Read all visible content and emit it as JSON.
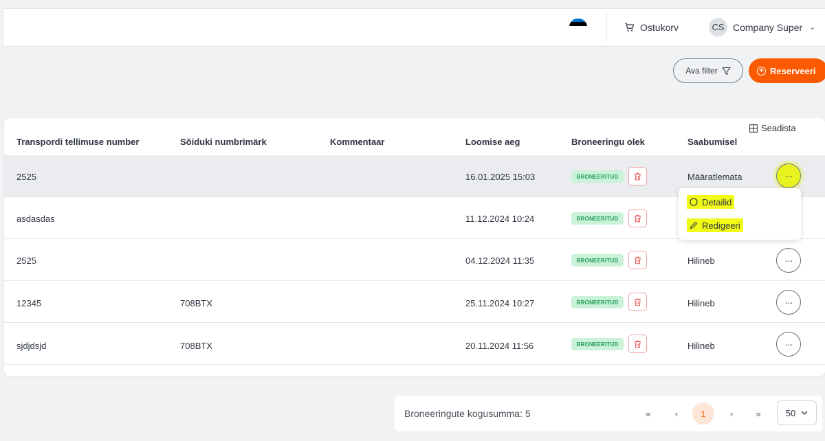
{
  "header": {
    "flag_colors": [
      "#0072ce",
      "#000000",
      "#ffffff"
    ],
    "cart_label": "Ostukorv",
    "user_initials": "CS",
    "user_name": "Company Super"
  },
  "toolbar": {
    "filter_label": "Ava filter",
    "reserve_label": "Reserveeri",
    "accent_color": "#fc5a00"
  },
  "table": {
    "settings_label": "Seadista",
    "columns": [
      "Transpordi tellimuse number",
      "Sõiduki numbrimärk",
      "Kommentaar",
      "Loomise aeg",
      "Broneeringu olek",
      "Saabumisel"
    ],
    "rows": [
      {
        "order": "2525",
        "plate": "",
        "comment": "",
        "created": "16.01.2025 15:03",
        "status": "BRONEERITUD",
        "arrival": "Määratlemata"
      },
      {
        "order": "asdasdas",
        "plate": "",
        "comment": "",
        "created": "11.12.2024 10:24",
        "status": "BRONEERITUD",
        "arrival": ""
      },
      {
        "order": "2525",
        "plate": "",
        "comment": "",
        "created": "04.12.2024 11:35",
        "status": "BRONEERITUD",
        "arrival": "Hilineb"
      },
      {
        "order": "12345",
        "plate": "708BTX",
        "comment": "",
        "created": "25.11.2024 10:27",
        "status": "BRONEERITUD",
        "arrival": "Hilineb"
      },
      {
        "order": "sjdjdsjd",
        "plate": "708BTX",
        "comment": "",
        "created": "20.11.2024 11:56",
        "status": "BRONEERITUD",
        "arrival": "Hilineb"
      }
    ],
    "menu": {
      "details_label": "Detailid",
      "edit_label": "Redigeeri"
    }
  },
  "pagination": {
    "total_label": "Broneeringute kogusumma: 5",
    "first": "«",
    "prev": "‹",
    "current_page": "1",
    "next": "›",
    "last": "»",
    "per_page": "50"
  }
}
